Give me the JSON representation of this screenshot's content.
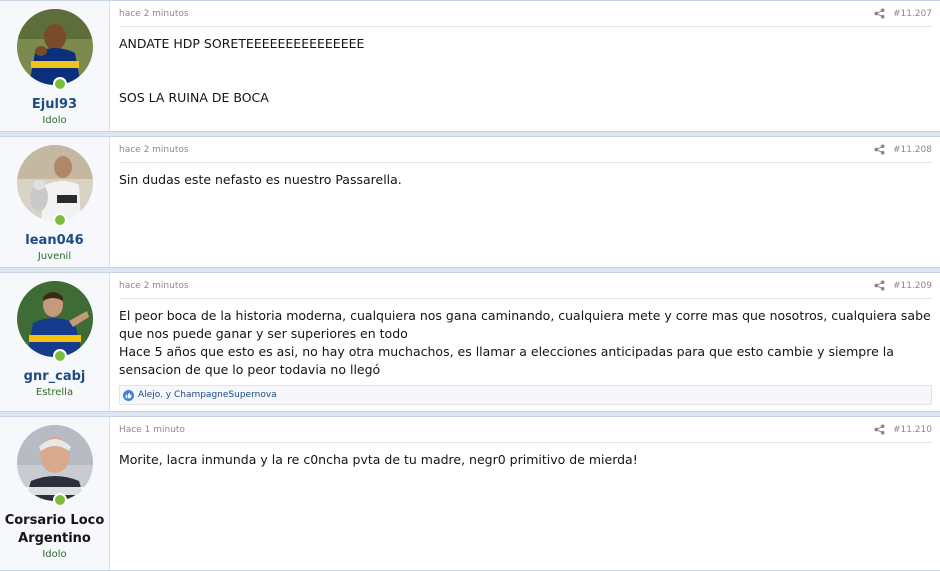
{
  "posts": [
    {
      "username": "Ejul93",
      "user_title": "Idolo",
      "time": "hace 2 minutos",
      "number": "#11.207",
      "body": "ANDATE HDP SORETEEEEEEEEEEEEEEE\n\n\nSOS LA RUINA DE BOCA"
    },
    {
      "username": "lean046",
      "user_title": "Juvenil",
      "time": "hace 2 minutos",
      "number": "#11.208",
      "body": "Sin dudas este nefasto es nuestro Passarella."
    },
    {
      "username": "gnr_cabj",
      "user_title": "Estrella",
      "time": "hace 2 minutos",
      "number": "#11.209",
      "body": "El peor boca de la historia moderna, cualquiera nos gana caminando, cualquiera mete y corre mas que nosotros, cualquiera sabe que nos puede ganar y ser superiores en todo\nHace 5 años que esto es asi, no hay otra muchachos, es llamar a elecciones anticipadas para que esto cambie y siempre la sensacion de que lo peor todavia no llegó",
      "reactions": "Alejo. y ChampagneSupernova"
    },
    {
      "username": "Corsario Loco Argentino",
      "user_title": "Idolo",
      "time": "Hace 1 minuto",
      "number": "#11.210",
      "body": "Morite, lacra inmunda y la re c0ncha pvta de tu madre, negr0 primitivo de mierda!"
    }
  ],
  "icons": {
    "share": "share-icon",
    "online": "online-status-icon",
    "like": "like-icon"
  },
  "colors": {
    "username_link": "#1d4b82",
    "user_title": "#2d6c27",
    "online": "#7cbd3c"
  }
}
